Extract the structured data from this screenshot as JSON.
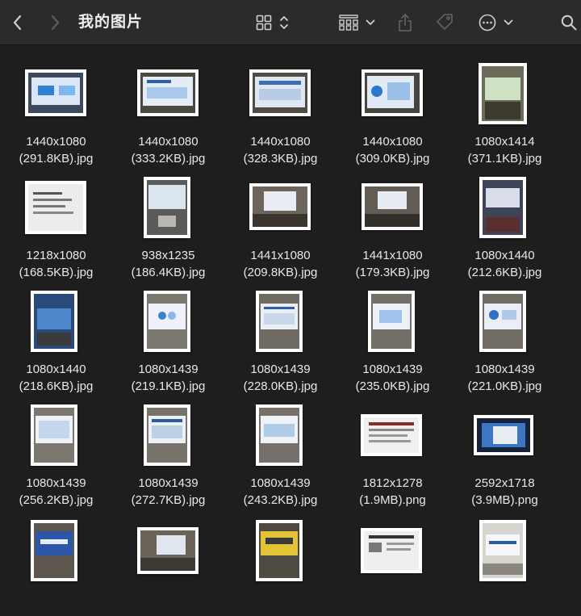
{
  "window": {
    "title": "我的图片",
    "icons": [
      "back-chevron-icon",
      "forward-chevron-icon",
      "grid-view-icon",
      "sort-arrows-icon",
      "group-icon",
      "chevron-down-icon",
      "share-icon",
      "tag-icon",
      "more-icon",
      "chevron-down-icon",
      "search-icon"
    ]
  },
  "files": [
    {
      "size_line": "1440x1080",
      "ext_line": "(291.8KB).jpg"
    },
    {
      "size_line": "1440x1080",
      "ext_line": "(333.2KB).jpg"
    },
    {
      "size_line": "1440x1080",
      "ext_line": "(328.3KB).jpg"
    },
    {
      "size_line": "1440x1080",
      "ext_line": "(309.0KB).jpg"
    },
    {
      "size_line": "1080x1414",
      "ext_line": "(371.1KB).jpg"
    },
    {
      "size_line": "1218x1080",
      "ext_line": "(168.5KB).jpg"
    },
    {
      "size_line": "938x1235",
      "ext_line": "(186.4KB).jpg"
    },
    {
      "size_line": "1441x1080",
      "ext_line": "(209.8KB).jpg"
    },
    {
      "size_line": "1441x1080",
      "ext_line": "(179.3KB).jpg"
    },
    {
      "size_line": "1080x1440",
      "ext_line": "(212.6KB).jpg"
    },
    {
      "size_line": "1080x1440",
      "ext_line": "(218.6KB).jpg"
    },
    {
      "size_line": "1080x1439",
      "ext_line": "(219.1KB).jpg"
    },
    {
      "size_line": "1080x1439",
      "ext_line": "(228.0KB).jpg"
    },
    {
      "size_line": "1080x1439",
      "ext_line": "(235.0KB).jpg"
    },
    {
      "size_line": "1080x1439",
      "ext_line": "(221.0KB).jpg"
    },
    {
      "size_line": "1080x1439",
      "ext_line": "(256.2KB).jpg"
    },
    {
      "size_line": "1080x1439",
      "ext_line": "(272.7KB).jpg"
    },
    {
      "size_line": "1080x1439",
      "ext_line": "(243.2KB).jpg"
    },
    {
      "size_line": "1812x1278",
      "ext_line": "(1.9MB).png"
    },
    {
      "size_line": "2592x1718",
      "ext_line": "(3.9MB).png"
    },
    {
      "size_line": "",
      "ext_line": ""
    },
    {
      "size_line": "",
      "ext_line": ""
    },
    {
      "size_line": "",
      "ext_line": ""
    },
    {
      "size_line": "",
      "ext_line": ""
    },
    {
      "size_line": "",
      "ext_line": ""
    }
  ]
}
